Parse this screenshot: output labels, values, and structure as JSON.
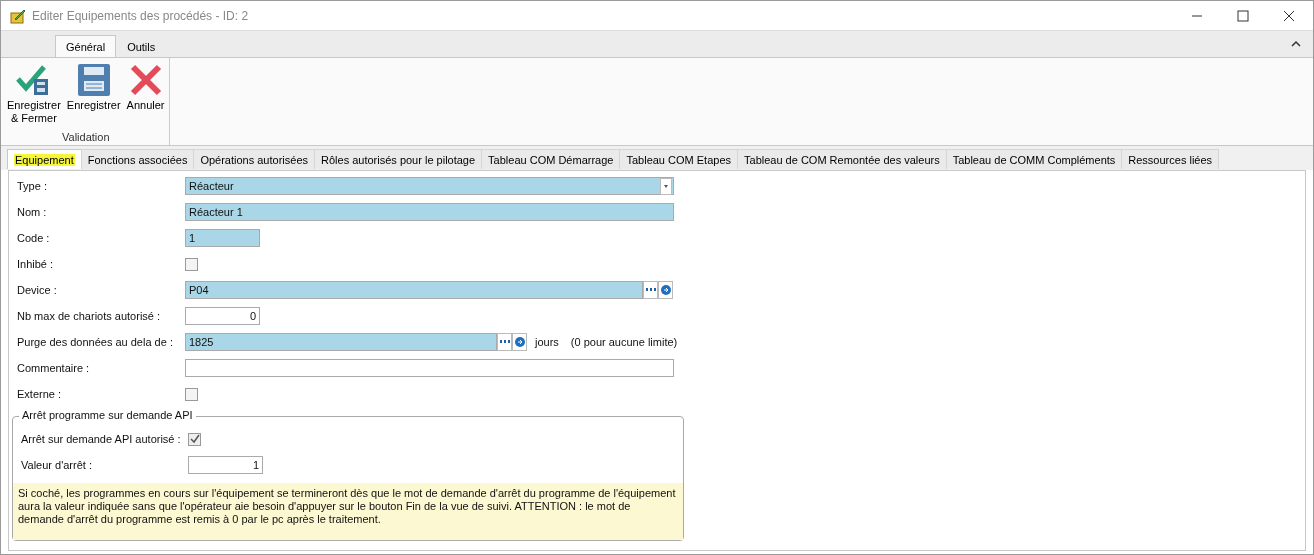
{
  "window": {
    "title": "Editer Equipements des procédés - ID: 2"
  },
  "ribbon": {
    "tabs": [
      {
        "label": "Général",
        "selected": true
      },
      {
        "label": "Outils",
        "selected": false
      }
    ],
    "groups": [
      {
        "label": "Validation",
        "buttons": [
          {
            "kind": "save-close",
            "label": "Enregistrer\n& Fermer"
          },
          {
            "kind": "save",
            "label": "Enregistrer"
          },
          {
            "kind": "cancel",
            "label": "Annuler"
          }
        ]
      }
    ]
  },
  "tabs": [
    {
      "label": "Equipement",
      "selected": true
    },
    {
      "label": "Fonctions associées",
      "selected": false
    },
    {
      "label": "Opérations autorisées",
      "selected": false
    },
    {
      "label": "Rôles autorisés pour le pilotage",
      "selected": false
    },
    {
      "label": "Tableau COM Démarrage",
      "selected": false
    },
    {
      "label": "Tableau COM Etapes",
      "selected": false
    },
    {
      "label": "Tableau de COM Remontée des valeurs",
      "selected": false
    },
    {
      "label": "Tableau de COMM Compléments",
      "selected": false
    },
    {
      "label": "Ressources liées",
      "selected": false
    }
  ],
  "fields": [
    {
      "kind": "combo",
      "label": "Type :",
      "value": "Réacteur"
    },
    {
      "kind": "text",
      "label": "Nom :",
      "value": "Réacteur 1"
    },
    {
      "kind": "short",
      "label": "Code :",
      "value": "1"
    },
    {
      "kind": "checkbox",
      "label": "Inhibé :",
      "checked": false
    },
    {
      "kind": "lookup",
      "label": "Device :",
      "value": "P04"
    },
    {
      "kind": "number",
      "label": "Nb max de chariots autorisé :",
      "value": "0"
    },
    {
      "kind": "lookup",
      "label": "Purge des données au dela de :",
      "value": "1825",
      "suffix": "jours",
      "hint": "(0 pour aucune limite)"
    },
    {
      "kind": "plain",
      "label": "Commentaire :"
    },
    {
      "kind": "checkbox",
      "label": "Externe :",
      "checked": false
    }
  ],
  "group": {
    "title": "Arrêt programme sur demande API",
    "fields": [
      {
        "kind": "checkbox",
        "label": "Arrêt sur demande API autorisé :",
        "checked": true
      },
      {
        "kind": "number",
        "label": "Valeur d'arrêt :",
        "value": "1"
      }
    ],
    "note": "Si coché, les programmes en cours sur l'équipement se termineront dès que le mot de demande d'arrêt du programme de l'équipement aura la valeur indiquée sans que l'opérateur aie besoin d'appuyer sur le bouton Fin de la vue de suivi. ATTENTION : le mot de demande d'arrêt du programme est remis à 0 par le pc après le traitement."
  }
}
